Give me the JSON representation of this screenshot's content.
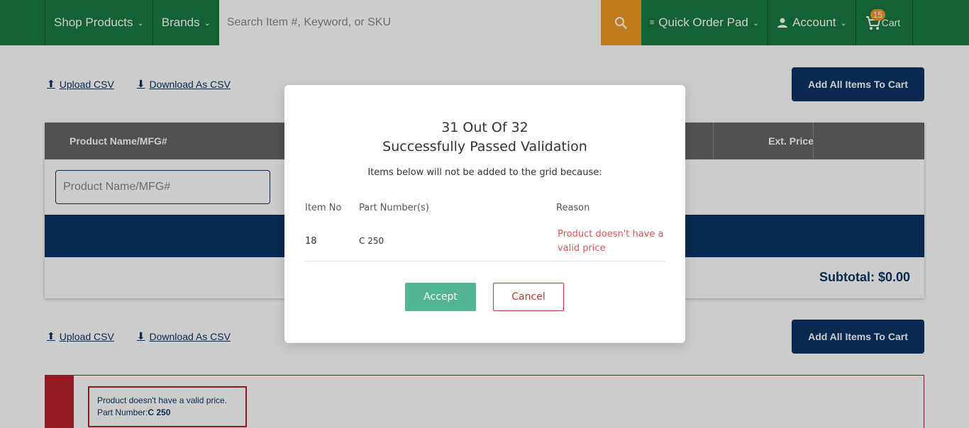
{
  "nav": {
    "shop_products": "Shop Products",
    "brands": "Brands",
    "search_placeholder": "Search Item #, Keyword, or SKU",
    "quick_order_pad": "Quick Order Pad",
    "account": "Account",
    "cart_label": "Cart",
    "cart_count": "15"
  },
  "toolbar": {
    "upload_csv": "Upload CSV",
    "download_csv": "Download As CSV",
    "add_all": "Add All Items To Cart"
  },
  "grid": {
    "header_product": "Product Name/MFG#",
    "header_ext_price": "Ext. Price",
    "filter_placeholder": "Product Name/MFG#",
    "subtotal": "Subtotal: $0.00"
  },
  "error_panel": {
    "message": "Product doesn't have a valid price.",
    "part_label": "Part Number:",
    "part_value": "C 250"
  },
  "modal": {
    "title_line1": "31 Out Of 32",
    "title_line2": "Successfully Passed Validation",
    "subtitle": "Items below will not be added to the grid because:",
    "col_item": "Item No",
    "col_part": "Part Number(s)",
    "col_reason": "Reason",
    "rows": [
      {
        "item": "18",
        "part": "C 250",
        "reason": "Product doesn't have a valid price"
      }
    ],
    "accept": "Accept",
    "cancel": "Cancel"
  },
  "colors": {
    "nav_green": "#1a7a40",
    "search_orange": "#f39a21",
    "primary_navy": "#0b3565",
    "accept_green": "#52b596",
    "error_red": "#b52128"
  }
}
